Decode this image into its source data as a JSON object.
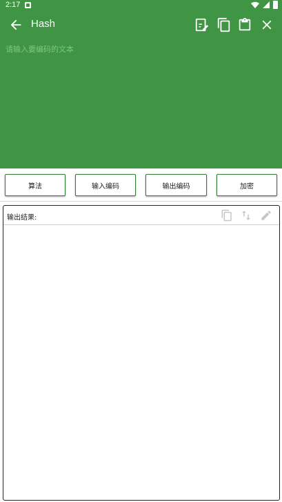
{
  "status_bar": {
    "time": "2:17"
  },
  "app_bar": {
    "title": "Hash",
    "icons": [
      "back-icon",
      "edit-note-icon",
      "copy-icon",
      "clipboard-icon",
      "close-icon"
    ]
  },
  "input": {
    "placeholder": "请输入要编码的文本",
    "value": ""
  },
  "buttons": {
    "algorithm": "算法",
    "input_encoding": "输入编码",
    "output_encoding": "输出编码",
    "encrypt": "加密"
  },
  "output": {
    "label": "输出结果:",
    "value": "",
    "icons": [
      "copy-icon",
      "swap-icon",
      "edit-icon"
    ]
  },
  "colors": {
    "primary": "#3f9543",
    "placeholder": "#7cc87f",
    "button_border": "#2e7d32"
  }
}
